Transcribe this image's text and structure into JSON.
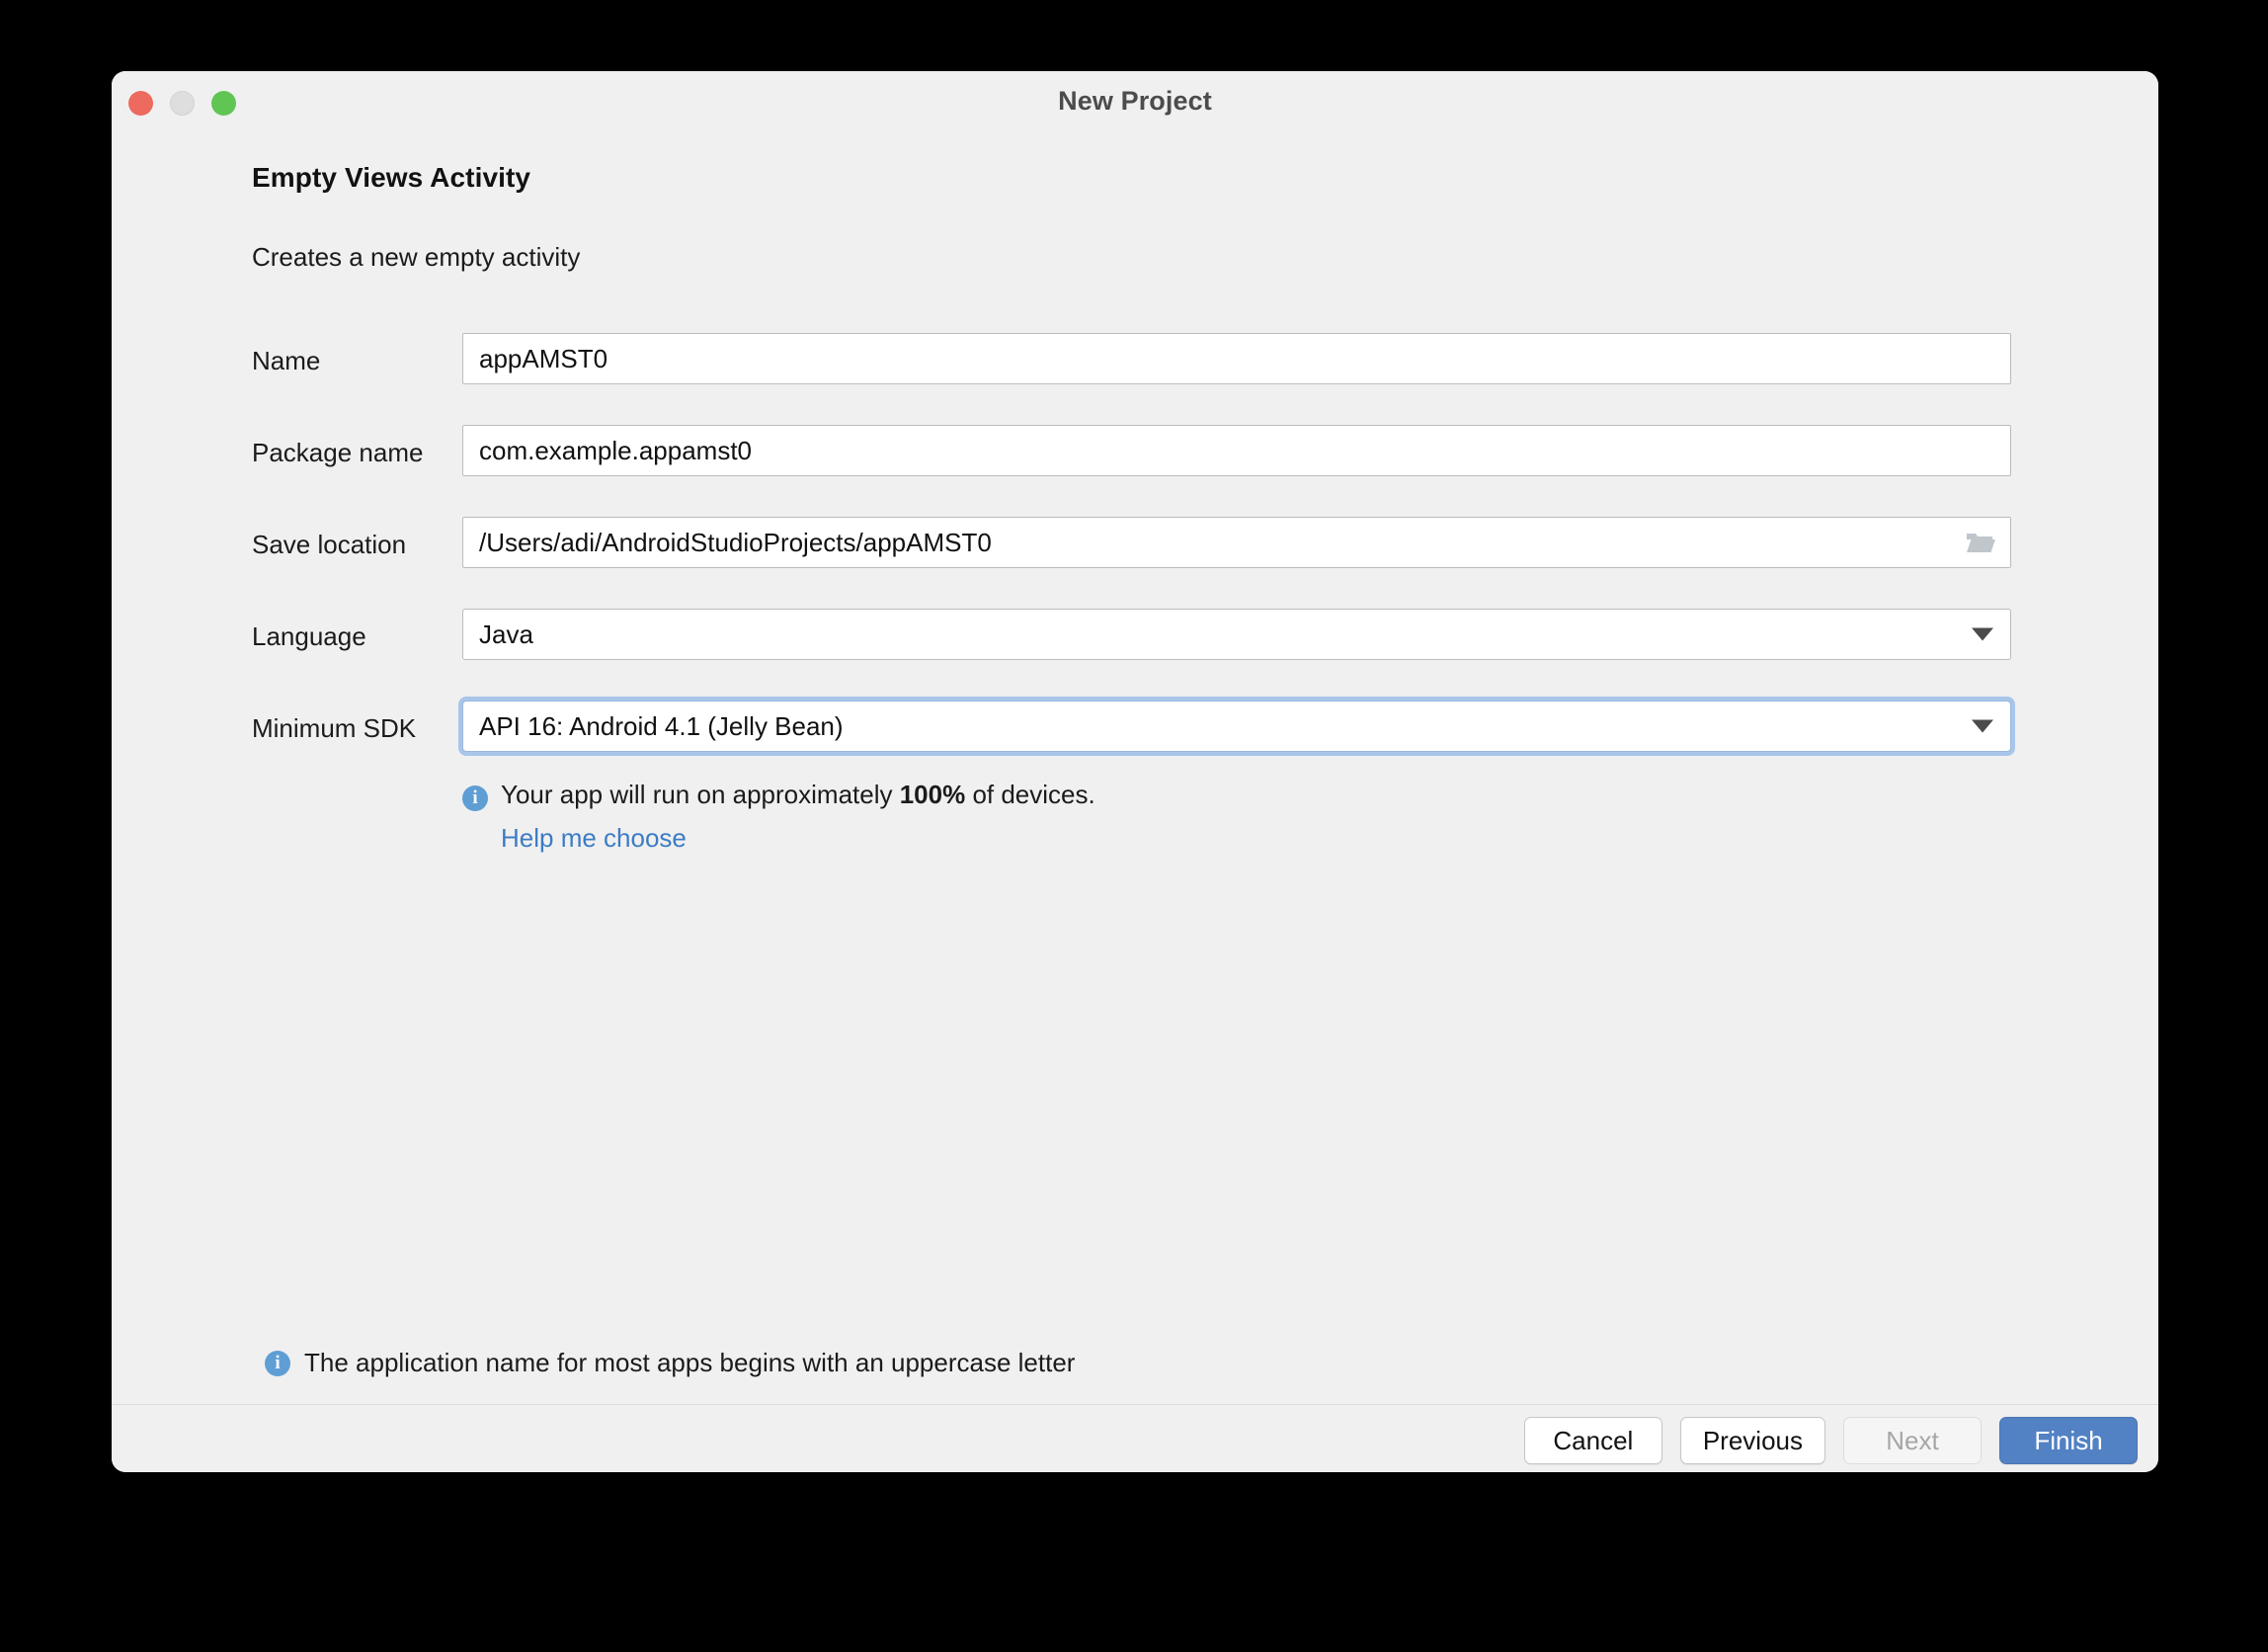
{
  "window": {
    "title": "New Project",
    "traffic_lights": [
      "close-button",
      "minimize-button",
      "maximize-button"
    ]
  },
  "wizard": {
    "heading": "Empty Views Activity",
    "subheading": "Creates a new empty activity"
  },
  "fields": {
    "name": {
      "label": "Name",
      "value": "appAMST0"
    },
    "package_name": {
      "label": "Package name",
      "value": "com.example.appamst0"
    },
    "save_location": {
      "label": "Save location",
      "value": "/Users/adi/AndroidStudioProjects/appAMST0",
      "icon": "folder-icon"
    },
    "language": {
      "label": "Language",
      "value": "Java",
      "icon": "chevron-down-icon"
    },
    "minimum_sdk": {
      "label": "Minimum SDK",
      "value": "API 16: Android 4.1 (Jelly Bean)",
      "icon": "chevron-down-icon",
      "focused": true
    }
  },
  "sdk_info": {
    "icon": "info-icon",
    "text_before": "Your app will run on approximately ",
    "percent": "100%",
    "text_after": " of devices.",
    "link": "Help me choose"
  },
  "bottom_hint": {
    "icon": "info-icon",
    "text": "The application name for most apps begins with an uppercase letter"
  },
  "footer": {
    "cancel": "Cancel",
    "previous": "Previous",
    "next": "Next",
    "finish": "Finish"
  },
  "colors": {
    "accent_blue": "#5281c4",
    "link_blue": "#3c7cc4",
    "info_blue": "#5f9ed4",
    "focus_ring": "#a8c5ea",
    "dialog_bg": "#f0f0f0"
  }
}
